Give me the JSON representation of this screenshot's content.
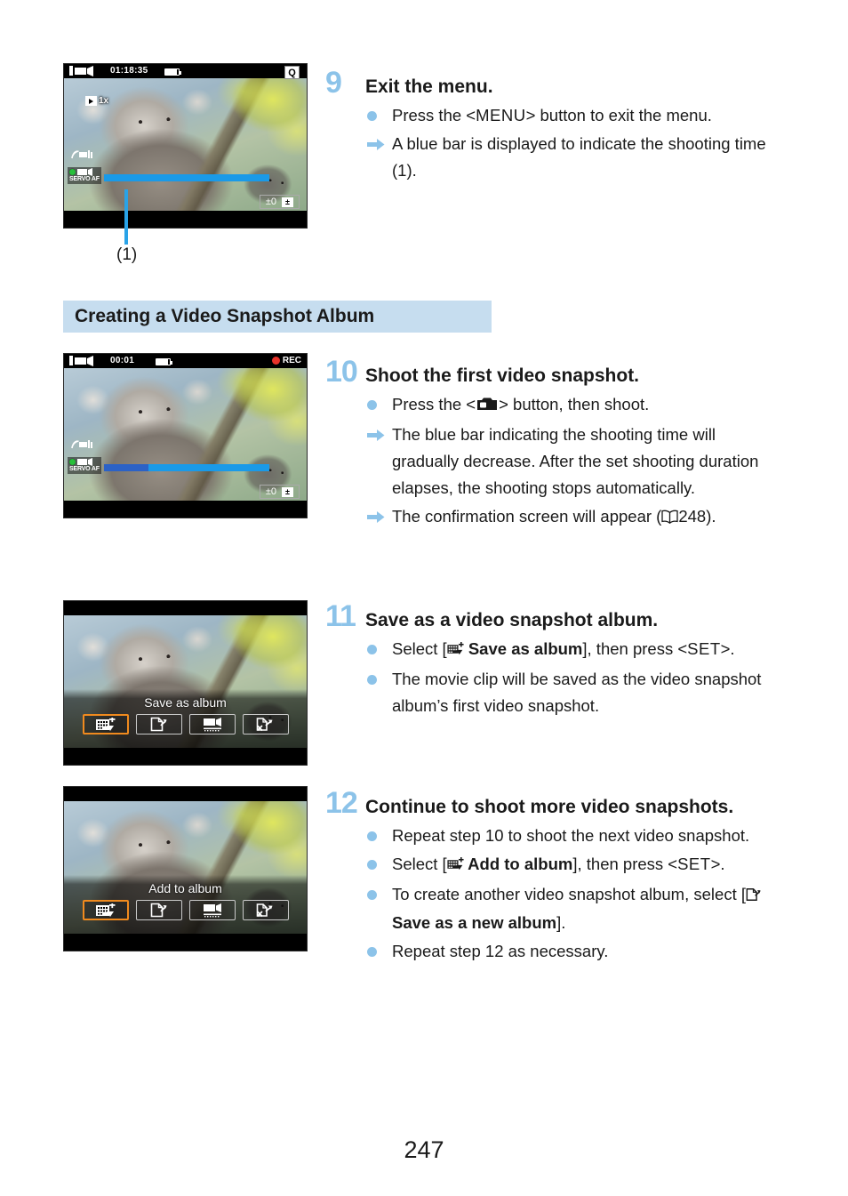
{
  "page": {
    "number": "247"
  },
  "section": {
    "heading": "Creating a Video Snapshot Album"
  },
  "callout": {
    "label": "(1)"
  },
  "screens": [
    {
      "id": "screen-exit-menu",
      "time": "01:18:35",
      "play_rate": "1x",
      "quick_menu_label": "Q",
      "servo_af_label": "SERVO AF",
      "exposure_comp": "±0",
      "progress_elapsed_pct": 0
    },
    {
      "id": "screen-recording",
      "time": "00:01",
      "rec_label": "REC",
      "servo_af_label": "SERVO AF",
      "exposure_comp": "±0",
      "progress_elapsed_pct": 27
    },
    {
      "id": "screen-save-as-album",
      "confirm_title": "Save as album",
      "buttons": [
        {
          "icon": "save-as-album-icon",
          "selected": true
        },
        {
          "icon": "save-as-new-album-icon",
          "selected": false
        },
        {
          "icon": "playback-album-icon",
          "selected": false
        },
        {
          "icon": "do-not-save-icon",
          "selected": false
        }
      ]
    },
    {
      "id": "screen-add-to-album",
      "confirm_title": "Add to album",
      "buttons": [
        {
          "icon": "add-to-album-icon",
          "selected": true
        },
        {
          "icon": "save-as-new-album-icon",
          "selected": false
        },
        {
          "icon": "playback-album-icon",
          "selected": false
        },
        {
          "icon": "do-not-save-icon",
          "selected": false
        }
      ]
    }
  ],
  "steps": [
    {
      "number": "9",
      "title": "Exit the menu.",
      "bullets": [
        {
          "marker": "dot",
          "parts": [
            {
              "t": "text",
              "v": "Press the <"
            },
            {
              "t": "menu",
              "v": "MENU"
            },
            {
              "t": "text",
              "v": "> button to exit the menu."
            }
          ]
        },
        {
          "marker": "arrow",
          "parts": [
            {
              "t": "text",
              "v": "A blue bar is displayed to indicate the shooting time (1)."
            }
          ]
        }
      ]
    },
    {
      "number": "10",
      "title": "Shoot the first video snapshot.",
      "bullets": [
        {
          "marker": "dot",
          "parts": [
            {
              "t": "text",
              "v": "Press the <"
            },
            {
              "t": "icon",
              "v": "camera-icon"
            },
            {
              "t": "text",
              "v": "> button, then shoot."
            }
          ]
        },
        {
          "marker": "arrow",
          "parts": [
            {
              "t": "text",
              "v": "The blue bar indicating the shooting time will gradually decrease. After the set shooting duration elapses, the shooting stops automatically."
            }
          ]
        },
        {
          "marker": "arrow",
          "parts": [
            {
              "t": "text",
              "v": "The confirmation screen will appear ("
            },
            {
              "t": "icon",
              "v": "book-icon"
            },
            {
              "t": "text",
              "v": "248)."
            }
          ]
        }
      ]
    },
    {
      "number": "11",
      "title": "Save as a video snapshot album.",
      "bullets": [
        {
          "marker": "dot",
          "parts": [
            {
              "t": "text",
              "v": "Select ["
            },
            {
              "t": "icon",
              "v": "save-as-album-icon"
            },
            {
              "t": "bold",
              "v": " Save as album"
            },
            {
              "t": "text",
              "v": "], then press <"
            },
            {
              "t": "menu",
              "v": "SET"
            },
            {
              "t": "text",
              "v": ">."
            }
          ]
        },
        {
          "marker": "dot",
          "parts": [
            {
              "t": "text",
              "v": "The movie clip will be saved as the video snapshot album’s first video snapshot."
            }
          ]
        }
      ]
    },
    {
      "number": "12",
      "title": "Continue to shoot more video snapshots.",
      "bullets": [
        {
          "marker": "dot",
          "parts": [
            {
              "t": "text",
              "v": "Repeat step 10 to shoot the next video snapshot."
            }
          ]
        },
        {
          "marker": "dot",
          "parts": [
            {
              "t": "text",
              "v": "Select ["
            },
            {
              "t": "icon",
              "v": "add-to-album-icon"
            },
            {
              "t": "bold",
              "v": " Add to album"
            },
            {
              "t": "text",
              "v": "], then press <"
            },
            {
              "t": "menu",
              "v": "SET"
            },
            {
              "t": "text",
              "v": ">."
            }
          ]
        },
        {
          "marker": "dot",
          "parts": [
            {
              "t": "text",
              "v": "To create another video snapshot album, select ["
            },
            {
              "t": "icon",
              "v": "save-as-new-album-icon"
            },
            {
              "t": "bold",
              "v": " Save as a new album"
            },
            {
              "t": "text",
              "v": "]."
            }
          ]
        },
        {
          "marker": "dot",
          "parts": [
            {
              "t": "text",
              "v": "Repeat step 12 as necessary."
            }
          ]
        }
      ]
    }
  ],
  "colors": {
    "accent_blue": "#8cc3e9",
    "band_blue": "#c6ddef",
    "progress_blue": "#1a9ae8",
    "progress_elapsed_blue": "#2c62c6",
    "selection_orange": "#f08a1e",
    "rec_red": "#e8322a"
  }
}
